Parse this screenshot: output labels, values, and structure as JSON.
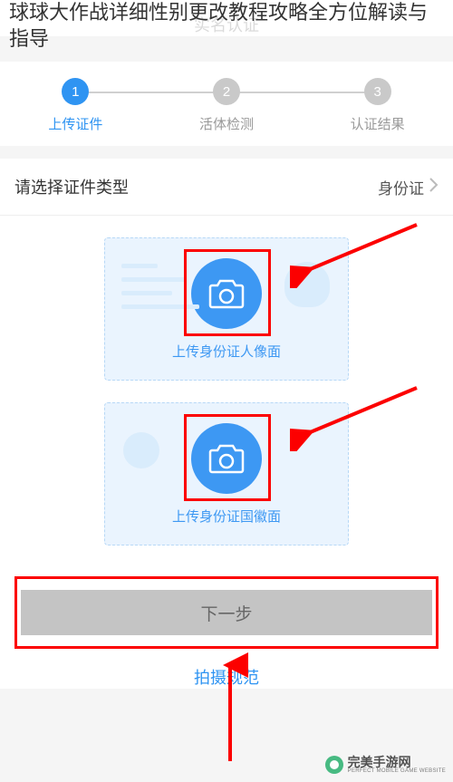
{
  "article_title": "球球大作战详细性别更改教程攻略全方位解读与指导",
  "header": {
    "title": "实名认证"
  },
  "steps": [
    {
      "num": "1",
      "label": "上传证件"
    },
    {
      "num": "2",
      "label": "活体检测"
    },
    {
      "num": "3",
      "label": "认证结果"
    }
  ],
  "doc_type": {
    "label": "请选择证件类型",
    "value": "身份证"
  },
  "upload": {
    "front_label": "上传身份证人像面",
    "back_label": "上传身份证国徽面"
  },
  "next_button": "下一步",
  "spec_link": "拍摄规范",
  "watermark": {
    "cn": "完美手游网",
    "en": "PERFECT MOBILE GAME WEBSITE"
  },
  "colors": {
    "primary": "#2F94F2",
    "highlight": "#fc0000",
    "disabled_bg": "#c4c4c4"
  }
}
